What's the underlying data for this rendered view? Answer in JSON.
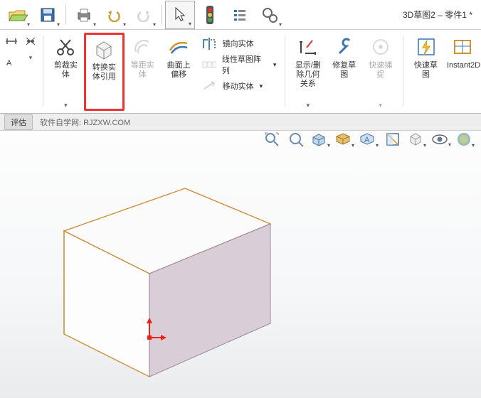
{
  "doc_title": "3D草图2 – 零件1 *",
  "topbar": {
    "open_dd": "▾",
    "save_dd": "▾",
    "print_dd": "▾",
    "undo_dd": "▾",
    "redo_dd": "▾",
    "select_dd": "▾",
    "options_dd": "▾"
  },
  "ribbon": {
    "trim_label": "剪裁实体",
    "convert_label": "转换实体引用",
    "offset_label": "等距实体",
    "surface_offset_label": "曲面上偏移",
    "mirror_label": "镜向实体",
    "linear_pattern_label": "线性草图阵列",
    "move_label": "移动实体",
    "display_rel_label": "显示/删除几何关系",
    "repair_label": "修复草图",
    "rapid_label": "快速捕捉",
    "quick_sketch_label": "快速草图",
    "instant_label": "Instant2D"
  },
  "panel": {
    "eval": "评估",
    "site": "软件自学网: RJZXW.COM"
  },
  "chart_data": null
}
